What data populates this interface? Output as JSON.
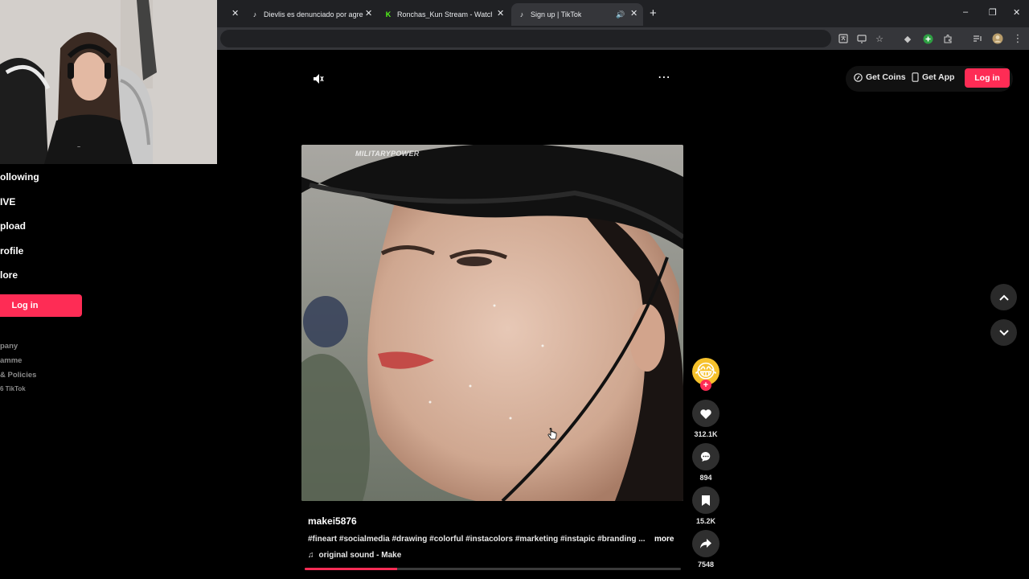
{
  "browser": {
    "tabs": [
      {
        "label": "",
        "active": false
      },
      {
        "label": "Dievlis es denunciado por agre",
        "active": false
      },
      {
        "label": "Ronchas_Kun Stream - Watch Li",
        "active": false
      },
      {
        "label": "Sign up | TikTok",
        "active": true
      }
    ],
    "new_tab": "+",
    "window_controls": [
      "–",
      "❐",
      "✕"
    ]
  },
  "sidebar": {
    "items": [
      {
        "label": "ollowing"
      },
      {
        "label": "IVE"
      },
      {
        "label": "pload"
      },
      {
        "label": "rofile"
      },
      {
        "label": "lore"
      }
    ],
    "login_label": "Log in",
    "footer": [
      {
        "label": "pany"
      },
      {
        "label": "amme"
      },
      {
        "label": "& Policies"
      },
      {
        "label": "6 TikTok"
      }
    ]
  },
  "header": {
    "get_coins": "Get Coins",
    "get_app": "Get App",
    "login_label": "Log in",
    "more_icon": "⋯"
  },
  "video": {
    "watermark": "MILITARYPOWER",
    "author": "makei5876",
    "description": "#fineart #socialmedia #drawing #colorful #instacolors #marketing #instapic #branding ...",
    "more_label": "more",
    "sound": "original sound - Make",
    "progress": 0.245
  },
  "actions": {
    "avatar_emoji": "😂",
    "follow_plus": "+",
    "likes": "312.1K",
    "comments": "894",
    "saves": "15.2K",
    "shares": "7548"
  },
  "colors": {
    "accent": "#fe2c55",
    "background": "#000000",
    "chrome_dark": "#202124",
    "chrome_mid": "#35363a"
  }
}
